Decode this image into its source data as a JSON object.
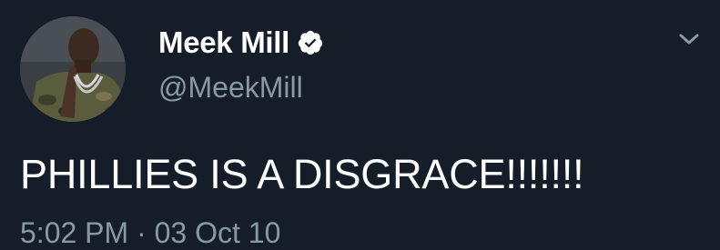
{
  "tweet": {
    "author": {
      "display_name": "Meek Mill",
      "handle": "@MeekMill",
      "verified": true,
      "avatar_icon": "profile-photo"
    },
    "text": "PHILLIES IS A DISGRACE!!!!!!!",
    "timestamp": "5:02 PM · 03 Oct 10",
    "menu_icon": "chevron-down-icon"
  },
  "colors": {
    "background": "#151d28",
    "primary_text": "#ffffff",
    "secondary_text": "#8899a6",
    "verified_badge": "#ffffff"
  }
}
